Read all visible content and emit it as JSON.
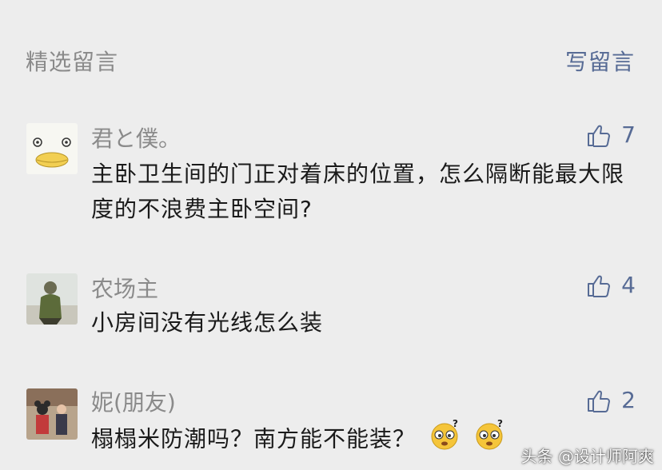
{
  "header": {
    "title": "精选留言",
    "write_label": "写留言"
  },
  "colors": {
    "link": "#576b95",
    "meta": "#8a8a8a",
    "text": "#1a1a1a",
    "background": "#ededed"
  },
  "comments": [
    {
      "avatar_icon": "duck-face-avatar",
      "nickname": "君と僕。",
      "likes": "7",
      "content": "主卧卫生间的门正对着床的位置，怎么隔断能最大限度的不浪费主卧空间?"
    },
    {
      "avatar_icon": "person-photo-avatar",
      "nickname": "农场主",
      "likes": "4",
      "content": "小房间没有光线怎么装"
    },
    {
      "avatar_icon": "people-photo-avatar",
      "nickname": "妮(朋友)",
      "likes": "2",
      "content": "榻榻米防潮吗？南方能不能装？",
      "emojis": [
        "confused-face-emoji",
        "confused-face-emoji"
      ]
    }
  ],
  "watermark": {
    "text": "头条 @设计师阿爽"
  }
}
